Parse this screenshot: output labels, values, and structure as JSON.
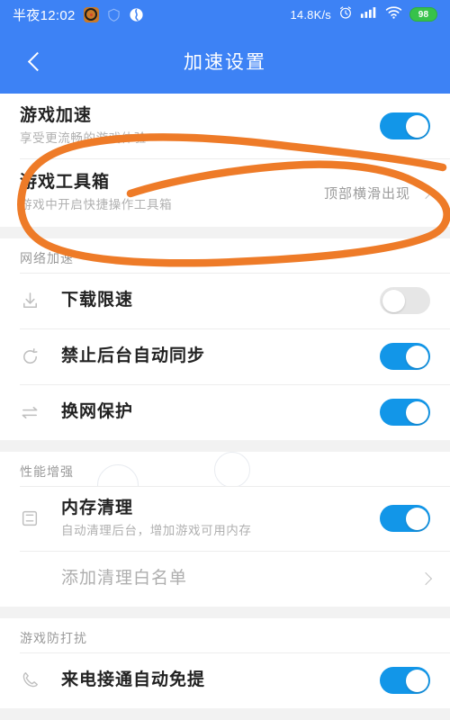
{
  "statusbar": {
    "time": "半夜12:02",
    "network_speed": "14.8K/s",
    "battery_level": "98",
    "icons": [
      "app-icon",
      "shield-icon",
      "browser-icon",
      "alarm-icon",
      "cellular-signal-icon",
      "wifi-icon",
      "battery-icon"
    ]
  },
  "appbar": {
    "title": "加速设置",
    "back_icon": "chevron-left-icon"
  },
  "groups": [
    {
      "header": null,
      "rows": [
        {
          "title": "游戏加速",
          "subtitle": "享受更流畅的游戏体验",
          "control": "toggle",
          "state": "on",
          "icon": null
        },
        {
          "title": "游戏工具箱",
          "subtitle": "游戏中开启快捷操作工具箱",
          "control": "value",
          "value": "顶部横滑出现",
          "icon": null
        }
      ]
    },
    {
      "header": "网络加速",
      "rows": [
        {
          "title": "下载限速",
          "subtitle": null,
          "control": "toggle",
          "state": "off",
          "icon": "download-icon"
        },
        {
          "title": "禁止后台自动同步",
          "subtitle": null,
          "control": "toggle",
          "state": "on",
          "icon": "sync-icon"
        },
        {
          "title": "换网保护",
          "subtitle": null,
          "control": "toggle",
          "state": "on",
          "icon": "swap-icon"
        }
      ]
    },
    {
      "header": "性能增强",
      "rows": [
        {
          "title": "内存清理",
          "subtitle": "自动清理后台，增加游戏可用内存",
          "control": "toggle",
          "state": "on",
          "icon": "memory-icon"
        },
        {
          "title": "添加清理白名单",
          "subtitle": null,
          "control": "chevron",
          "icon": null
        }
      ]
    },
    {
      "header": "游戏防打扰",
      "rows": [
        {
          "title": "来电接通自动免提",
          "subtitle": null,
          "control": "toggle",
          "state": "on",
          "icon": "phone-icon"
        }
      ]
    }
  ],
  "annotation": {
    "color": "#ee7b28",
    "shape": "hand-drawn-ellipse",
    "target": "游戏工具箱"
  },
  "colors": {
    "header_blue": "#3d82f5",
    "toggle_on": "#1296e8",
    "toggle_off": "#e6e6e6",
    "battery_green": "#37c24a",
    "annotation_orange": "#ee7b28"
  }
}
